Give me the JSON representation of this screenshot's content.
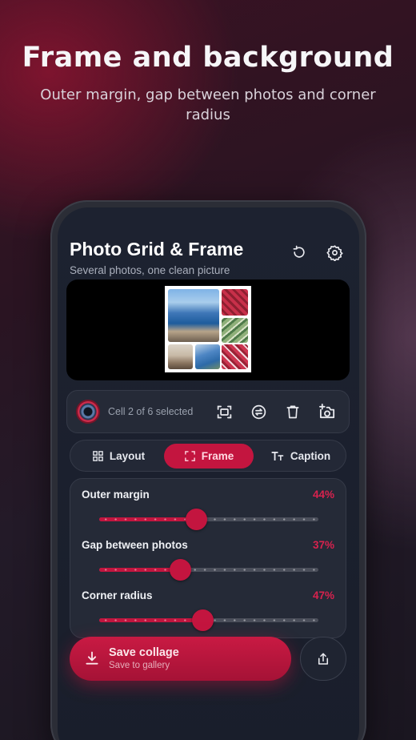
{
  "promo": {
    "title": "Frame and background",
    "subtitle": "Outer margin, gap between photos and corner radius"
  },
  "app": {
    "title": "Photo Grid & Frame",
    "subtitle": "Several photos, one clean picture",
    "header_icons": [
      "reset-icon",
      "gear-icon"
    ]
  },
  "cell_toolbar": {
    "status": "Cell 2 of 6 selected",
    "tools": [
      "crop-frame-icon",
      "swap-icon",
      "trash-icon",
      "add-photo-icon"
    ]
  },
  "tabs": [
    {
      "label": "Layout",
      "icon": "grid-icon",
      "active": false
    },
    {
      "label": "Frame",
      "icon": "frame-icon",
      "active": true
    },
    {
      "label": "Caption",
      "icon": "text-size-icon",
      "active": false
    }
  ],
  "sliders": [
    {
      "label": "Outer margin",
      "value_text": "44%",
      "value": 0.44
    },
    {
      "label": "Gap between photos",
      "value_text": "37%",
      "value": 0.37
    },
    {
      "label": "Corner radius",
      "value_text": "47%",
      "value": 0.47
    }
  ],
  "save": {
    "label": "Save collage",
    "sublabel": "Save to gallery"
  },
  "colors": {
    "accent": "#c3153f",
    "value_text": "#d8224e",
    "background": "#191e2b"
  }
}
